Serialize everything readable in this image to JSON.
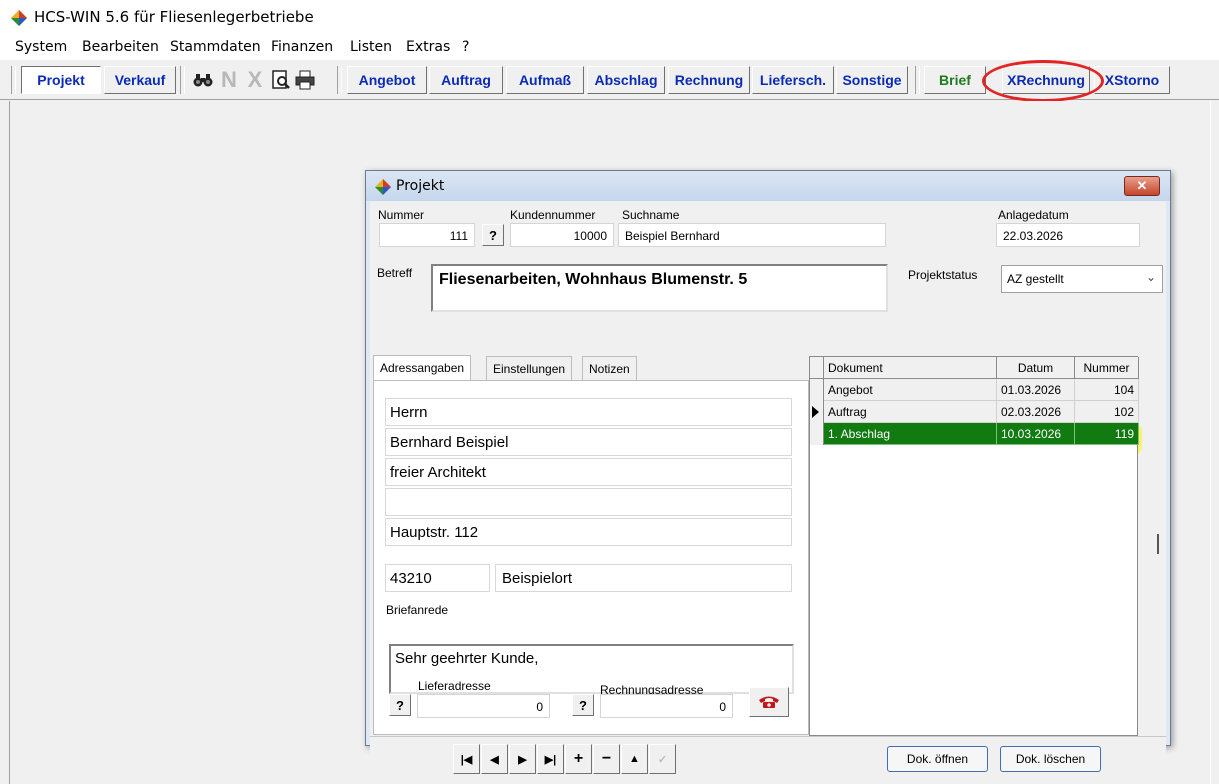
{
  "app": {
    "title": "HCS-WIN 5.6 für Fliesenlegerbetriebe"
  },
  "menu": [
    "System",
    "Bearbeiten",
    "Stammdaten",
    "Finanzen",
    "Listen",
    "Extras",
    "?"
  ],
  "toolbar": {
    "projekt": "Projekt",
    "verkauf": "Verkauf",
    "n_label": "N",
    "x_label": "X",
    "angebot": "Angebot",
    "auftrag": "Auftrag",
    "aufmass": "Aufmaß",
    "abschlag": "Abschlag",
    "rechnung": "Rechnung",
    "lieferschein": "Liefersch.",
    "sonstige": "Sonstige",
    "brief": "Brief",
    "xrechnung": "XRechnung",
    "xstorno": "XStorno",
    "icons": [
      "binoculars-icon",
      "preview-icon",
      "printer-icon"
    ]
  },
  "dialog": {
    "title": "Projekt",
    "close": "✕",
    "nummer_label": "Nummer",
    "nummer": "111",
    "kundennummer_label": "Kundennummer",
    "kundennummer": "10000",
    "suchname_label": "Suchname",
    "suchname": "Beispiel Bernhard",
    "anlagedatum_label": "Anlagedatum",
    "anlagedatum": "22.03.2026",
    "betreff_label": "Betreff",
    "betreff": "Fliesenarbeiten, Wohnhaus Blumenstr. 5",
    "projektstatus_label": "Projektstatus",
    "projektstatus": "AZ gestellt",
    "help": "?"
  },
  "tabs": [
    "Adressangaben",
    "Einstellungen",
    "Notizen"
  ],
  "address": {
    "lines": [
      "Herrn",
      "Bernhard Beispiel",
      "freier Architekt",
      "",
      "Hauptstr. 112"
    ],
    "plz": "43210",
    "ort": "Beispielort",
    "briefanrede_label": "Briefanrede",
    "briefanrede": "Sehr geehrter Kunde,",
    "lieferadresse_label": "Lieferadresse",
    "lieferadresse": "0",
    "rechnungsadresse_label": "Rechnungsadresse",
    "rechnungsadresse": "0"
  },
  "documents": {
    "headers": [
      "Dokument",
      "Datum",
      "Nummer"
    ],
    "rows": [
      [
        "Angebot",
        "01.03.2026",
        "104"
      ],
      [
        "Auftrag",
        "02.03.2026",
        "102"
      ],
      [
        "1. Abschlag",
        "10.03.2026",
        "119"
      ]
    ]
  },
  "navbar": {
    "open": "Dok. öffnen",
    "delete": "Dok. löschen"
  },
  "colors": {
    "accent": "#0a2ab8",
    "selection": "#117a11",
    "annotation": "#e32424",
    "highlight": "#fff500"
  }
}
